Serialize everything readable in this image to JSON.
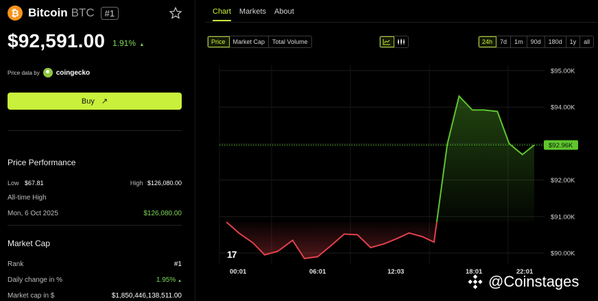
{
  "coin": {
    "logo_glyph": "₿",
    "name": "Bitcoin",
    "symbol": "BTC",
    "rank_badge": "#1",
    "price": "$92,591.00",
    "change": "1.91%",
    "change_arrow": "▲",
    "price_data_label": "Price data by",
    "provider": "coingecko",
    "buy_label": "Buy",
    "buy_arrow": "↗"
  },
  "performance": {
    "title": "Price Performance",
    "low_label": "Low",
    "low_value": "$67.81",
    "high_label": "High",
    "high_value": "$126,080.00",
    "ath_label": "All-time High",
    "ath_date": "Mon, 6 Oct 2025",
    "ath_value": "$126,080.00"
  },
  "market_cap": {
    "title": "Market Cap",
    "rank_label": "Rank",
    "rank_value": "#1",
    "daily_label": "Daily change in %",
    "daily_value": "1.95%",
    "daily_arrow": "▲",
    "cap_label": "Market cap in $",
    "cap_value": "$1,850,446,138,511.00"
  },
  "tabs": [
    "Chart",
    "Markets",
    "About"
  ],
  "metric_buttons": [
    "Price",
    "Market Cap",
    "Total Volume"
  ],
  "range_buttons": [
    "24h",
    "7d",
    "1m",
    "90d",
    "180d",
    "1y",
    "all"
  ],
  "chart_type_icons": [
    "line-chart-icon",
    "candlestick-icon"
  ],
  "watermark": {
    "text": "@Coinstages",
    "tv_logo": "17"
  },
  "colors": {
    "accent": "#c9f03b",
    "up": "#5fc52e",
    "down": "#e0414b",
    "bitcoin": "#f7931a"
  },
  "chart_data": {
    "type": "line",
    "x_labels": [
      "00:01",
      "06:01",
      "12:03",
      "18:01",
      "22:01"
    ],
    "y_labels": [
      "$95.00K",
      "$94.00K",
      "$93.00K",
      "$92.00K",
      "$91.00K",
      "$90.00K"
    ],
    "ylim": [
      89.7,
      95.15
    ],
    "baseline": 90.85,
    "current_label": "$92.96K",
    "current_value": 92.96,
    "series": [
      {
        "values": [
          [
            0.0,
            90.85
          ],
          [
            0.85,
            90.55
          ],
          [
            1.8,
            90.28
          ],
          [
            2.6,
            89.95
          ],
          [
            3.5,
            90.05
          ],
          [
            4.5,
            90.35
          ],
          [
            5.3,
            89.85
          ],
          [
            6.2,
            89.9
          ],
          [
            7.1,
            90.2
          ],
          [
            8.0,
            90.52
          ],
          [
            8.9,
            90.5
          ],
          [
            9.8,
            90.15
          ],
          [
            10.7,
            90.25
          ],
          [
            11.6,
            90.4
          ],
          [
            12.4,
            90.55
          ],
          [
            13.3,
            90.45
          ],
          [
            14.1,
            90.3
          ],
          [
            15.0,
            92.98
          ],
          [
            15.8,
            94.3
          ],
          [
            16.7,
            93.92
          ],
          [
            17.5,
            93.92
          ],
          [
            18.4,
            93.88
          ],
          [
            19.2,
            93.0
          ],
          [
            20.1,
            92.7
          ],
          [
            20.9,
            92.96
          ]
        ]
      }
    ],
    "grid": true
  }
}
